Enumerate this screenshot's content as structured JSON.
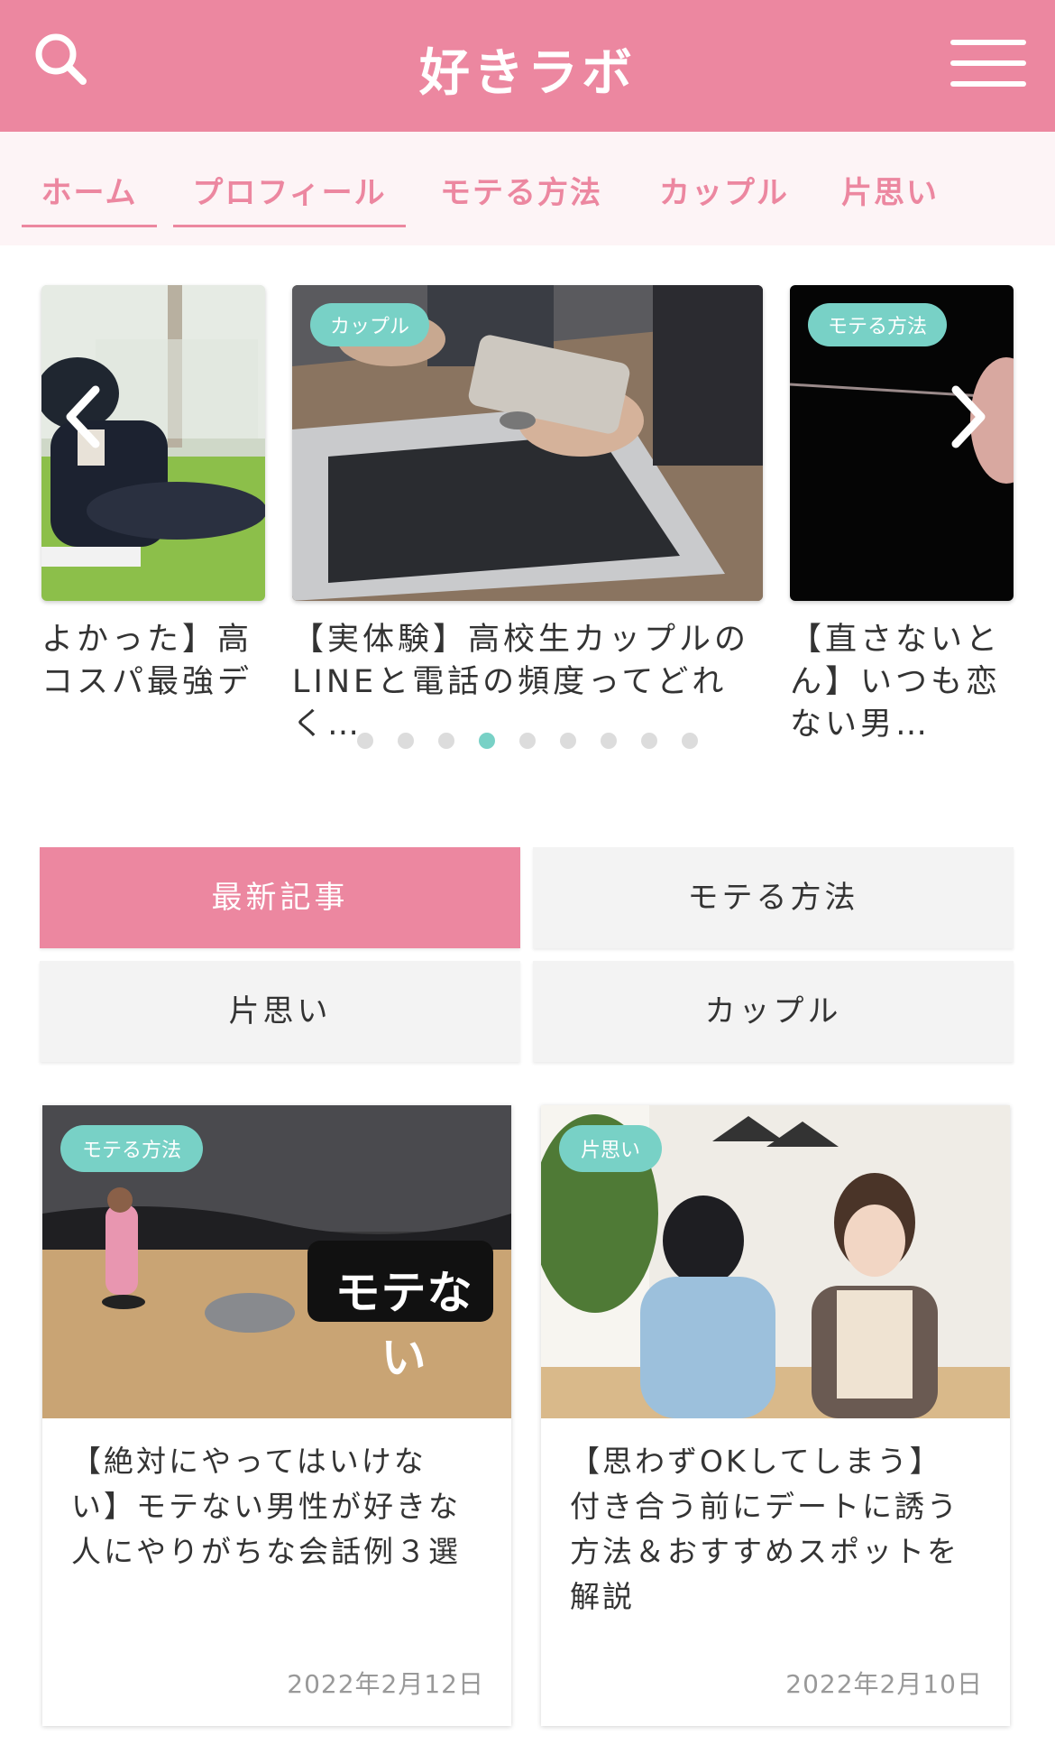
{
  "header": {
    "title": "好きラボ",
    "search_icon": "search-icon",
    "menu_icon": "hamburger-menu-icon"
  },
  "nav": {
    "items": [
      {
        "label": "ホーム",
        "active": true
      },
      {
        "label": "プロフィール",
        "active": true
      },
      {
        "label": "モテる方法",
        "active": false
      },
      {
        "label": "カップル",
        "active": false
      },
      {
        "label": "片思い",
        "active": false
      }
    ]
  },
  "carousel": {
    "slides": [
      {
        "tag": "",
        "title": "よかった】高\nコスパ最強デ"
      },
      {
        "tag": "カップル",
        "title": "【実体験】高校生カップルの\nLINEと電話の頻度ってどれ\nく…"
      },
      {
        "tag": "モテる方法",
        "title": "【直さないと\nん】いつも恋\nない男…"
      }
    ],
    "dot_count": 9,
    "active_dot": 4,
    "prev_icon": "chevron-left-icon",
    "next_icon": "chevron-right-icon"
  },
  "tabs": [
    {
      "label": "最新記事",
      "active": true
    },
    {
      "label": "モテる方法",
      "active": false
    },
    {
      "label": "片思い",
      "active": false
    },
    {
      "label": "カップル",
      "active": false
    }
  ],
  "cards": [
    {
      "tag": "モテる方法",
      "sign_text": "モテない",
      "title": "【絶対にやってはいけな\nい】モテない男性が好きな\n人にやりがちな会話例３選",
      "date": "2022年2月12日"
    },
    {
      "tag": "片思い",
      "title": "【思わずOKしてしまう】\n付き合う前にデートに誘う\n方法＆おすすめスポットを\n解説",
      "date": "2022年2月10日"
    }
  ],
  "colors": {
    "brand_pink": "#ec87a0",
    "accent_teal": "#78d1c6",
    "tab_bg": "#f3f3f3"
  }
}
